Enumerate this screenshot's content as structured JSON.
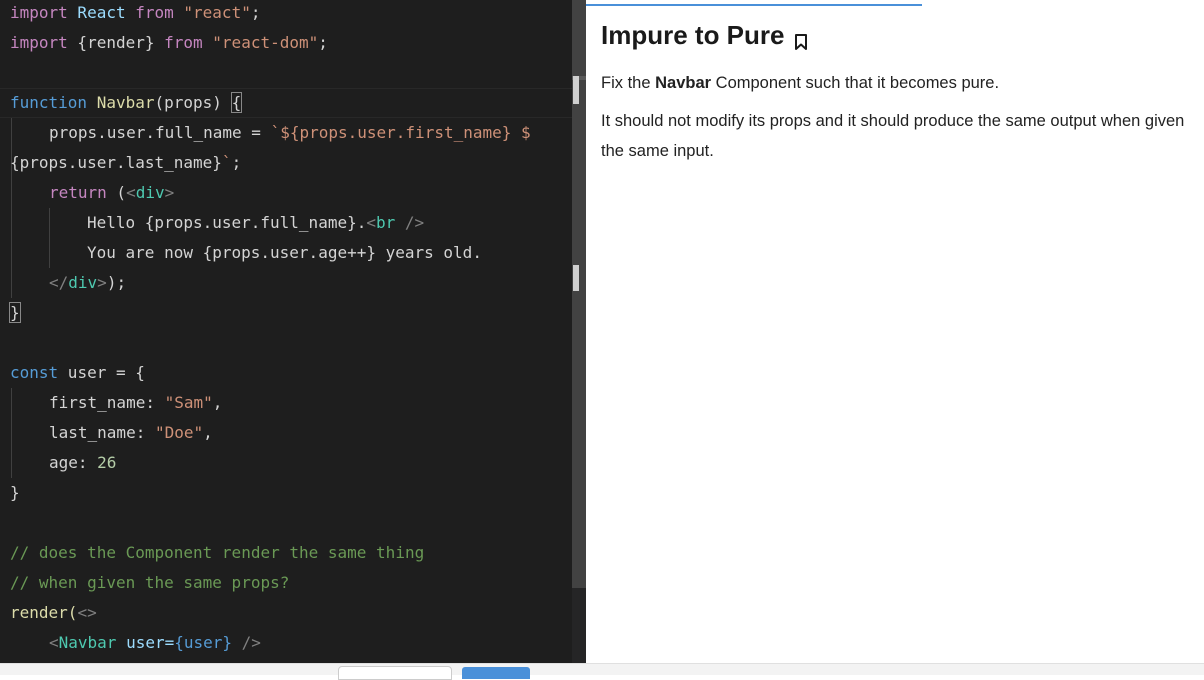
{
  "editor": {
    "lines": {
      "l1": {
        "t1": "import",
        "t2": " React ",
        "t3": "from",
        "t4": " \"react\"",
        "t5": ";"
      },
      "l2": {
        "t1": "import",
        "t2": " {render} ",
        "t3": "from",
        "t4": " \"react-dom\"",
        "t5": ";"
      },
      "l4": {
        "t1": "function",
        "t2": " ",
        "t3": "Navbar",
        "t4": "(props) ",
        "t5": "{"
      },
      "l5": {
        "t1": "props.user.full_name = ",
        "t2": "`${props.user.first_name} $"
      },
      "l6": {
        "t1": "{props.user.last_name}",
        "t2": "`",
        "t3": ";"
      },
      "l7": {
        "t1": "return",
        "t2": " (",
        "t3": "<",
        "t4": "div",
        "t5": ">"
      },
      "l8": {
        "t1": "Hello {props.user.full_name}.",
        "t2": "<",
        "t3": "br",
        "t4": " />"
      },
      "l9": {
        "t1": "You are now {props.user.age++} years old."
      },
      "l10": {
        "t1": "</",
        "t2": "div",
        "t3": ">",
        "t4": ");"
      },
      "l11": {
        "t1": "}"
      },
      "l13": {
        "t1": "const",
        "t2": " user = {"
      },
      "l14": {
        "t1": "first_name: ",
        "t2": "\"Sam\"",
        "t3": ","
      },
      "l15": {
        "t1": "last_name: ",
        "t2": "\"Doe\"",
        "t3": ","
      },
      "l16": {
        "t1": "age: ",
        "t2": "26"
      },
      "l17": {
        "t1": "}"
      },
      "l19": {
        "t1": "// does the Component render the same thing"
      },
      "l20": {
        "t1": "// when given the same props?"
      },
      "l21": {
        "t1": "render(",
        "t2": "<>"
      },
      "l22": {
        "t1": "<",
        "t2": "Navbar",
        "t3": " user=",
        "t4": "{user}",
        "t5": " />"
      }
    }
  },
  "instructions": {
    "title": "Impure to Pure",
    "p1_before": "Fix the ",
    "p1_bold": "Navbar",
    "p1_after": " Component such that it becomes pure.",
    "p2": "It should not modify its props and it should produce the same output when given the same input."
  },
  "icons": {
    "bookmark": "bookmark-icon"
  },
  "colors": {
    "editor_bg": "#1e1e1e",
    "accent": "#4a90d9"
  }
}
